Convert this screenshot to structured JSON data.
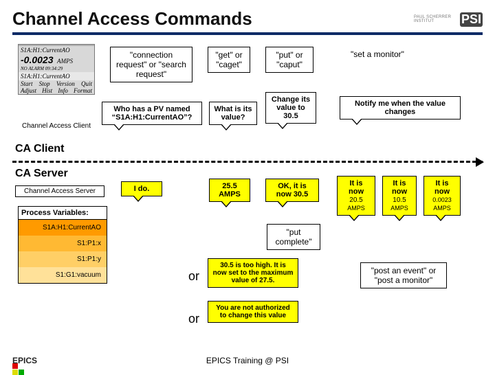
{
  "title": "Channel Access Commands",
  "psi_text": "PAUL SCHERRER INSTITUT",
  "psi_mark": "PSI",
  "client_window": {
    "bar": "  ",
    "pv": "S1A:H1:CurrentAO",
    "value": "-0.0023",
    "units": "AMPS",
    "alarm": "NO ALARM  09:34:29",
    "pv2": "S1A:H1:CurrentAO",
    "row1": [
      "Start",
      "Stop",
      "Version",
      "Quit"
    ],
    "row2": [
      "Adjust",
      "Hist",
      "Info",
      "Format"
    ]
  },
  "client_caption": "Channel Access Client",
  "row1": {
    "conn": "\"connection request\" or \"search request\"",
    "get": "\"get\" or \"caget\"",
    "put": "\"put\" or \"caput\"",
    "mon": "\"set a monitor\""
  },
  "row2": {
    "who": "Who has a PV named “S1A:H1:CurrentAO”?",
    "what": "What is its value?",
    "change": "Change its value to 30.5",
    "notify": "Notify me when the value changes"
  },
  "zone_client": "CA Client",
  "zone_server": "CA Server",
  "server_caption": "Channel Access Server",
  "row3": {
    "ido": "I do.",
    "val": "25.5 AMPS",
    "ok": "OK, it is now 30.5",
    "now1_a": "It is now",
    "now1_b": "20.5",
    "now1_c": "AMPS",
    "now2_a": "It is now",
    "now2_b": "10.5",
    "now2_c": "AMPS",
    "now3_a": "It is now",
    "now3_b": "0.0023",
    "now3_c": "AMPS"
  },
  "put_complete": "\"put complete\"",
  "or": "or",
  "resp1": "30.5 is too high. It is now set to the maximum value of 27.5.",
  "resp2": "You are not authorized to change this value",
  "post": "\"post an event\" or \"post a monitor\"",
  "pv_box": {
    "hdr": "Process Variables:",
    "items": [
      "S1A:H1:CurrentAO",
      "S1:P1:x",
      "S1:P1:y",
      "S1:G1:vacuum"
    ]
  },
  "footer": "EPICS Training @ PSI",
  "epics": "EPICS"
}
